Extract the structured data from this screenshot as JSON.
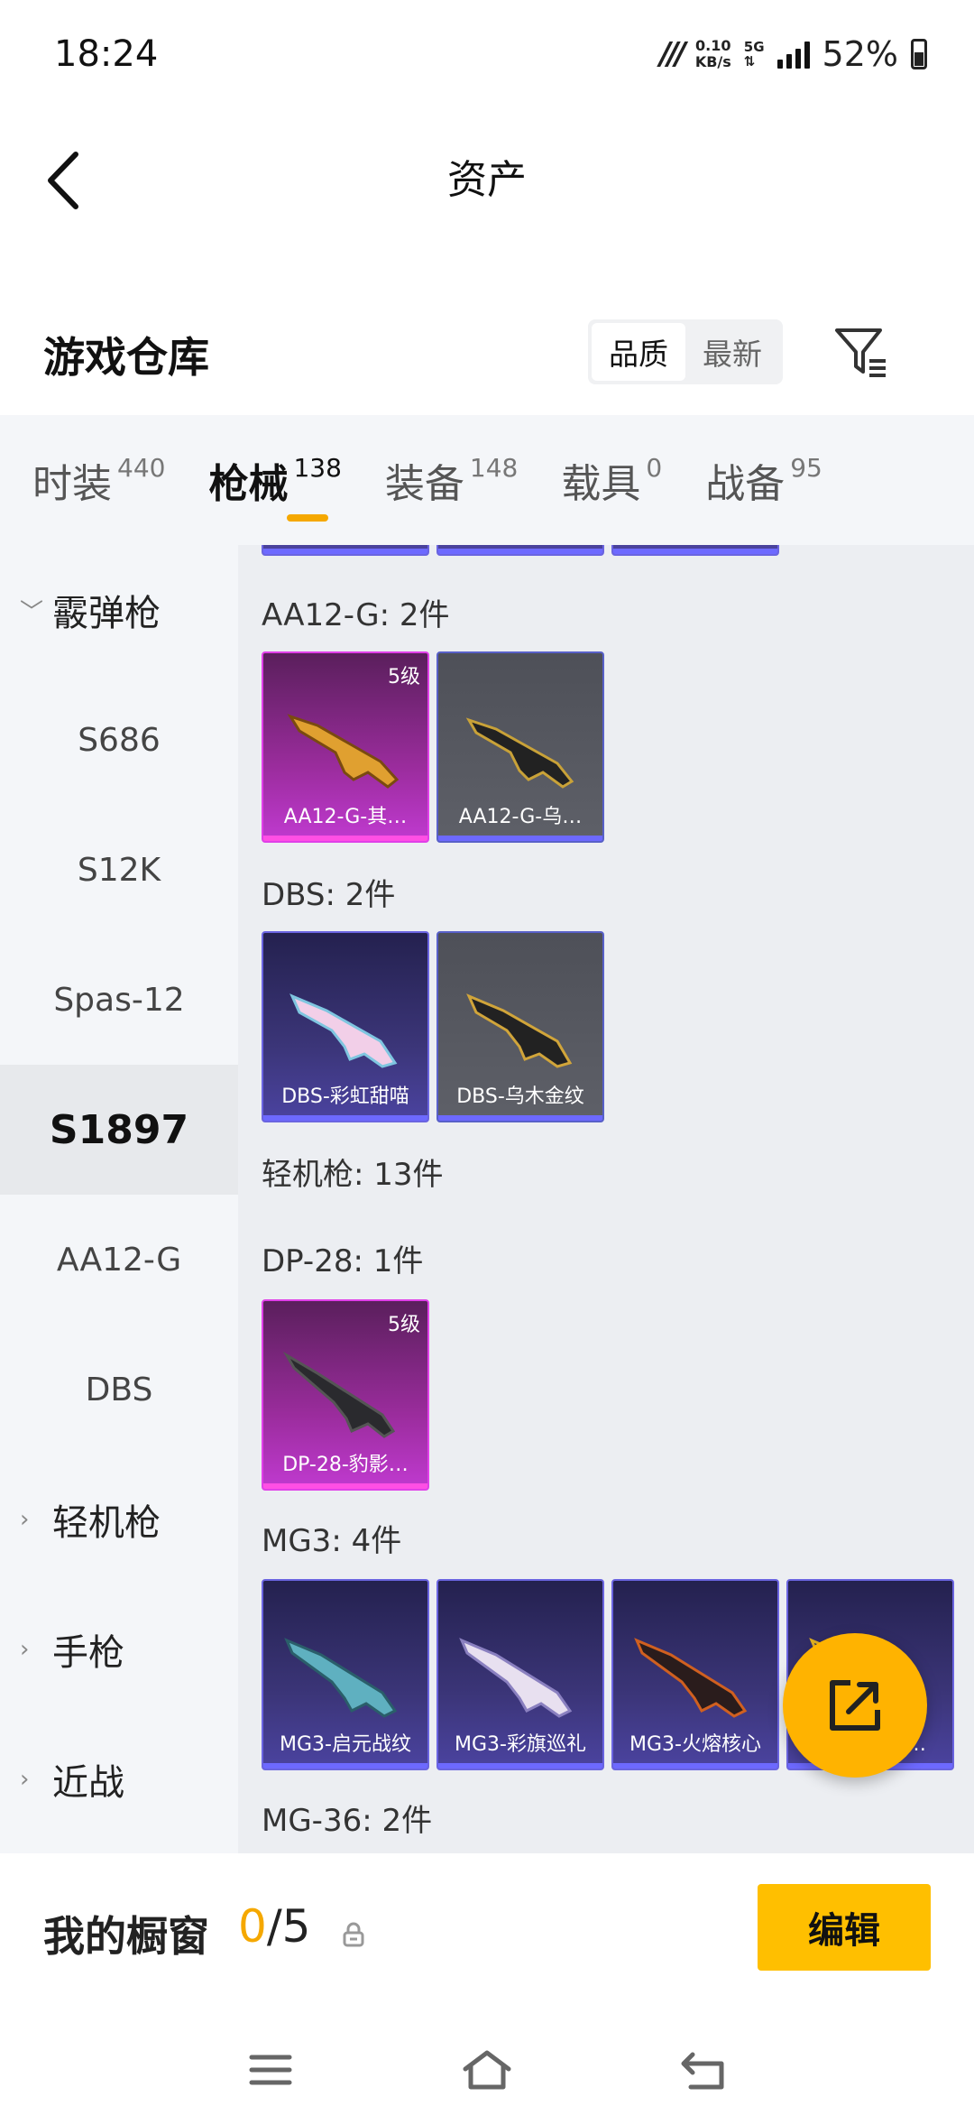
{
  "status_bar": {
    "time": "18:24",
    "speed_value": "0.10",
    "speed_unit": "KB/s",
    "network": "5G",
    "battery": "52%"
  },
  "header": {
    "title": "资产"
  },
  "warehouse": {
    "title": "游戏仓库",
    "sort_options": [
      "品质",
      "最新"
    ],
    "active_sort": "品质"
  },
  "tabs": [
    {
      "label": "时装",
      "count": "440"
    },
    {
      "label": "枪械",
      "count": "138"
    },
    {
      "label": "装备",
      "count": "148"
    },
    {
      "label": "载具",
      "count": "0"
    },
    {
      "label": "战备",
      "count": "95"
    }
  ],
  "sidebar": {
    "group_shotgun": "霰弹枪",
    "items": [
      "S686",
      "S12K",
      "Spas-12",
      "S1897",
      "AA12-G",
      "DBS"
    ],
    "selected": "S1897",
    "group_lmg": "轻机枪",
    "group_pistol": "手枪",
    "group_melee": "近战"
  },
  "content": {
    "sections": [
      {
        "title": "AA12-G: 2件"
      },
      {
        "title": "DBS: 2件"
      },
      {
        "title": "轻机枪: 13件"
      },
      {
        "title": "DP-28: 1件"
      },
      {
        "title": "MG3: 4件"
      },
      {
        "title": "MG-36: 2件"
      }
    ],
    "cards": {
      "aa12_1": {
        "label": "AA12-G-其…",
        "level": "5级"
      },
      "aa12_2": {
        "label": "AA12-G-乌…"
      },
      "dbs_1": {
        "label": "DBS-彩虹甜喵"
      },
      "dbs_2": {
        "label": "DBS-乌木金纹"
      },
      "dp28_1": {
        "label": "DP-28-豹影…",
        "level": "5级"
      },
      "mg3_1": {
        "label": "MG3-启元战纹"
      },
      "mg3_2": {
        "label": "MG3-彩旗巡礼"
      },
      "mg3_3": {
        "label": "MG3-火熔核心"
      },
      "mg3_4": {
        "label": "MG3-…战…"
      }
    }
  },
  "showcase": {
    "label": "我的橱窗",
    "current": "0",
    "total": "/5",
    "edit_label": "编辑"
  },
  "colors": {
    "accent": "#f5a800",
    "edit_button": "#ffbf00",
    "fab": "#ffb300"
  }
}
